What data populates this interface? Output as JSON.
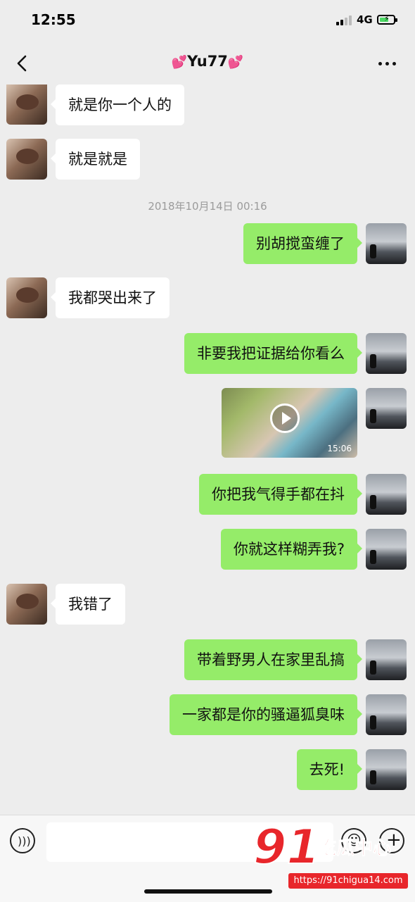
{
  "status_bar": {
    "time": "12:55",
    "network": "4G"
  },
  "nav": {
    "title": "Yu77",
    "title_decoration": "💕"
  },
  "timestamp": "2018年10月14日 00:16",
  "messages": [
    {
      "side": "in",
      "text": "就是你一个人的"
    },
    {
      "side": "in",
      "text": "就是就是"
    },
    {
      "side": "out",
      "text": "别胡搅蛮缠了"
    },
    {
      "side": "in",
      "text": "我都哭出来了"
    },
    {
      "side": "out",
      "text": "非要我把证据给你看么"
    },
    {
      "side": "out",
      "type": "video",
      "duration": "15:06"
    },
    {
      "side": "out",
      "text": "你把我气得手都在抖"
    },
    {
      "side": "out",
      "text": "你就这样糊弄我?"
    },
    {
      "side": "in",
      "text": "我错了"
    },
    {
      "side": "out",
      "text": "带着野男人在家里乱搞"
    },
    {
      "side": "out",
      "text": "一家都是你的骚逼狐臭味"
    },
    {
      "side": "out",
      "text": "去死!"
    }
  ],
  "input": {
    "placeholder": ""
  },
  "icons": {
    "voice": "voice-icon",
    "emoji": "emoji-icon",
    "plus": "plus-icon",
    "back": "back-icon",
    "more": "more-icon"
  },
  "watermark": {
    "number": "91",
    "text": "吃瓜中心",
    "url": "https://91chigua14.com"
  },
  "colors": {
    "outgoing_bubble": "#95ec69",
    "incoming_bubble": "#ffffff",
    "background": "#ededed"
  }
}
